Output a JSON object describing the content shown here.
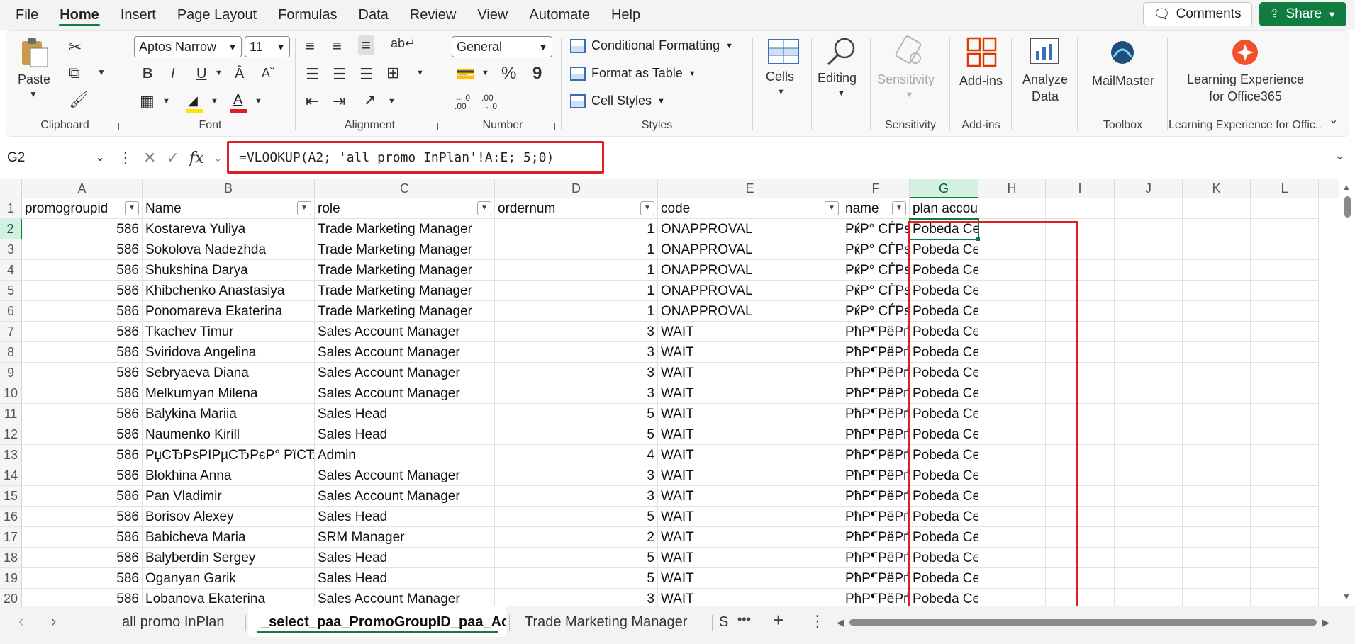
{
  "menu": {
    "tabs": [
      "File",
      "Home",
      "Insert",
      "Page Layout",
      "Formulas",
      "Data",
      "Review",
      "View",
      "Automate",
      "Help"
    ],
    "active": "Home",
    "comments_label": "Comments",
    "share_label": "Share"
  },
  "ribbon": {
    "clipboard": {
      "paste": "Paste",
      "label": "Clipboard"
    },
    "font": {
      "name": "Aptos Narrow",
      "size": "11",
      "label": "Font",
      "bold": "B",
      "italic": "I",
      "underline": "U"
    },
    "alignment": {
      "label": "Alignment"
    },
    "number": {
      "format": "General",
      "label": "Number",
      "percent": "%",
      "comma": "9",
      "inc_decimal": "←.0\n.00",
      "dec_decimal": ".00\n→.0"
    },
    "styles": {
      "conditional": "Conditional Formatting",
      "format_table": "Format as Table",
      "cell_styles": "Cell Styles",
      "label": "Styles"
    },
    "cells": {
      "label": "Cells"
    },
    "editing": {
      "label": "Editing"
    },
    "sensitivity": {
      "button": "Sensitivity",
      "label": "Sensitivity"
    },
    "addins": {
      "button": "Add-ins",
      "label": "Add-ins"
    },
    "analyze": {
      "line1": "Analyze",
      "line2": "Data"
    },
    "mailmaster": {
      "button": "MailMaster",
      "label": "Toolbox"
    },
    "learning": {
      "line1": "Learning Experience",
      "line2": "for Office365",
      "label": "Learning Experience for Offic..."
    },
    "colors": {
      "font_color": "#e01e25",
      "highlight_color": "#ffe600",
      "accent": "#107c41"
    }
  },
  "formula_bar": {
    "name_box": "G2",
    "formula": "=VLOOKUP(A2; 'all promo InPlan'!A:E; 5;0)"
  },
  "grid": {
    "columns": [
      "A",
      "B",
      "C",
      "D",
      "E",
      "F",
      "G",
      "H",
      "I",
      "J",
      "K",
      "L"
    ],
    "selected_column": "G",
    "selected_row": "2",
    "header": {
      "A": "promogroupid",
      "B": "Name",
      "C": "role",
      "D": "ordernum",
      "E": "code",
      "F": "name",
      "G": "plan account"
    },
    "rows": [
      {
        "n": "2",
        "a": "586",
        "b": "Kostareva Yuliya",
        "c": "Trade Marketing Manager",
        "d": "1",
        "e": "ONAPPROVAL",
        "f": "РќР° СЃРѕ",
        "g": "Pobeda Center"
      },
      {
        "n": "3",
        "a": "586",
        "b": "Sokolova Nadezhda",
        "c": "Trade Marketing Manager",
        "d": "1",
        "e": "ONAPPROVAL",
        "f": "РќР° СЃРѕ",
        "g": "Pobeda Center"
      },
      {
        "n": "4",
        "a": "586",
        "b": "Shukshina Darya",
        "c": "Trade Marketing Manager",
        "d": "1",
        "e": "ONAPPROVAL",
        "f": "РќР° СЃРѕ",
        "g": "Pobeda Center"
      },
      {
        "n": "5",
        "a": "586",
        "b": "Khibchenko Anastasiya",
        "c": "Trade Marketing Manager",
        "d": "1",
        "e": "ONAPPROVAL",
        "f": "РќР° СЃРѕ",
        "g": "Pobeda Center"
      },
      {
        "n": "6",
        "a": "586",
        "b": "Ponomareva Ekaterina",
        "c": "Trade Marketing Manager",
        "d": "1",
        "e": "ONAPPROVAL",
        "f": "РќР° СЃРѕ",
        "g": "Pobeda Center"
      },
      {
        "n": "7",
        "a": "586",
        "b": "Tkachev Timur",
        "c": "Sales Account Manager",
        "d": "3",
        "e": "WAIT",
        "f": "РћР¶РёРґ",
        "g": "Pobeda Center"
      },
      {
        "n": "8",
        "a": "586",
        "b": "Sviridova Angelina",
        "c": "Sales Account Manager",
        "d": "3",
        "e": "WAIT",
        "f": "РћР¶РёРґ",
        "g": "Pobeda Center"
      },
      {
        "n": "9",
        "a": "586",
        "b": "Sebryaeva Diana",
        "c": "Sales Account Manager",
        "d": "3",
        "e": "WAIT",
        "f": "РћР¶РёРґ",
        "g": "Pobeda Center"
      },
      {
        "n": "10",
        "a": "586",
        "b": "Melkumyan Milena",
        "c": "Sales Account Manager",
        "d": "3",
        "e": "WAIT",
        "f": "РћР¶РёРґ",
        "g": "Pobeda Center"
      },
      {
        "n": "11",
        "a": "586",
        "b": "Balykina Mariia",
        "c": "Sales Head",
        "d": "5",
        "e": "WAIT",
        "f": "РћР¶РёРґ",
        "g": "Pobeda Center"
      },
      {
        "n": "12",
        "a": "586",
        "b": "Naumenko Kirill",
        "c": "Sales Head",
        "d": "5",
        "e": "WAIT",
        "f": "РћР¶РёРґ",
        "g": "Pobeda Center"
      },
      {
        "n": "13",
        "a": "586",
        "b": "РџСЂРѕРІРµСЂРєР° РїСЂ",
        "c": "Admin",
        "d": "4",
        "e": "WAIT",
        "f": "РћР¶РёРґ",
        "g": "Pobeda Center"
      },
      {
        "n": "14",
        "a": "586",
        "b": "Blokhina Anna",
        "c": "Sales Account Manager",
        "d": "3",
        "e": "WAIT",
        "f": "РћР¶РёРґ",
        "g": "Pobeda Center"
      },
      {
        "n": "15",
        "a": "586",
        "b": "Pan Vladimir",
        "c": "Sales Account Manager",
        "d": "3",
        "e": "WAIT",
        "f": "РћР¶РёРґ",
        "g": "Pobeda Center"
      },
      {
        "n": "16",
        "a": "586",
        "b": "Borisov Alexey",
        "c": "Sales Head",
        "d": "5",
        "e": "WAIT",
        "f": "РћР¶РёРґ",
        "g": "Pobeda Center"
      },
      {
        "n": "17",
        "a": "586",
        "b": "Babicheva Maria",
        "c": "SRM Manager",
        "d": "2",
        "e": "WAIT",
        "f": "РћР¶РёРґ",
        "g": "Pobeda Center"
      },
      {
        "n": "18",
        "a": "586",
        "b": "Balyberdin Sergey",
        "c": "Sales Head",
        "d": "5",
        "e": "WAIT",
        "f": "РћР¶РёРґ",
        "g": "Pobeda Center"
      },
      {
        "n": "19",
        "a": "586",
        "b": "Oganyan Garik",
        "c": "Sales Head",
        "d": "5",
        "e": "WAIT",
        "f": "РћР¶РёРґ",
        "g": "Pobeda Center"
      },
      {
        "n": "20",
        "a": "586",
        "b": "Lobanova Ekaterina",
        "c": "Sales Account Manager",
        "d": "3",
        "e": "WAIT",
        "f": "РћР¶РёРґ",
        "g": "Pobeda Center"
      }
    ]
  },
  "sheet_tabs": {
    "tabs": [
      "all promo InPlan",
      "_select_paa_PromoGroupID_paa_Ac",
      "Trade Marketing Manager",
      "S"
    ],
    "active_index": 1,
    "more": "•••",
    "add": "+",
    "options": "⋮"
  }
}
